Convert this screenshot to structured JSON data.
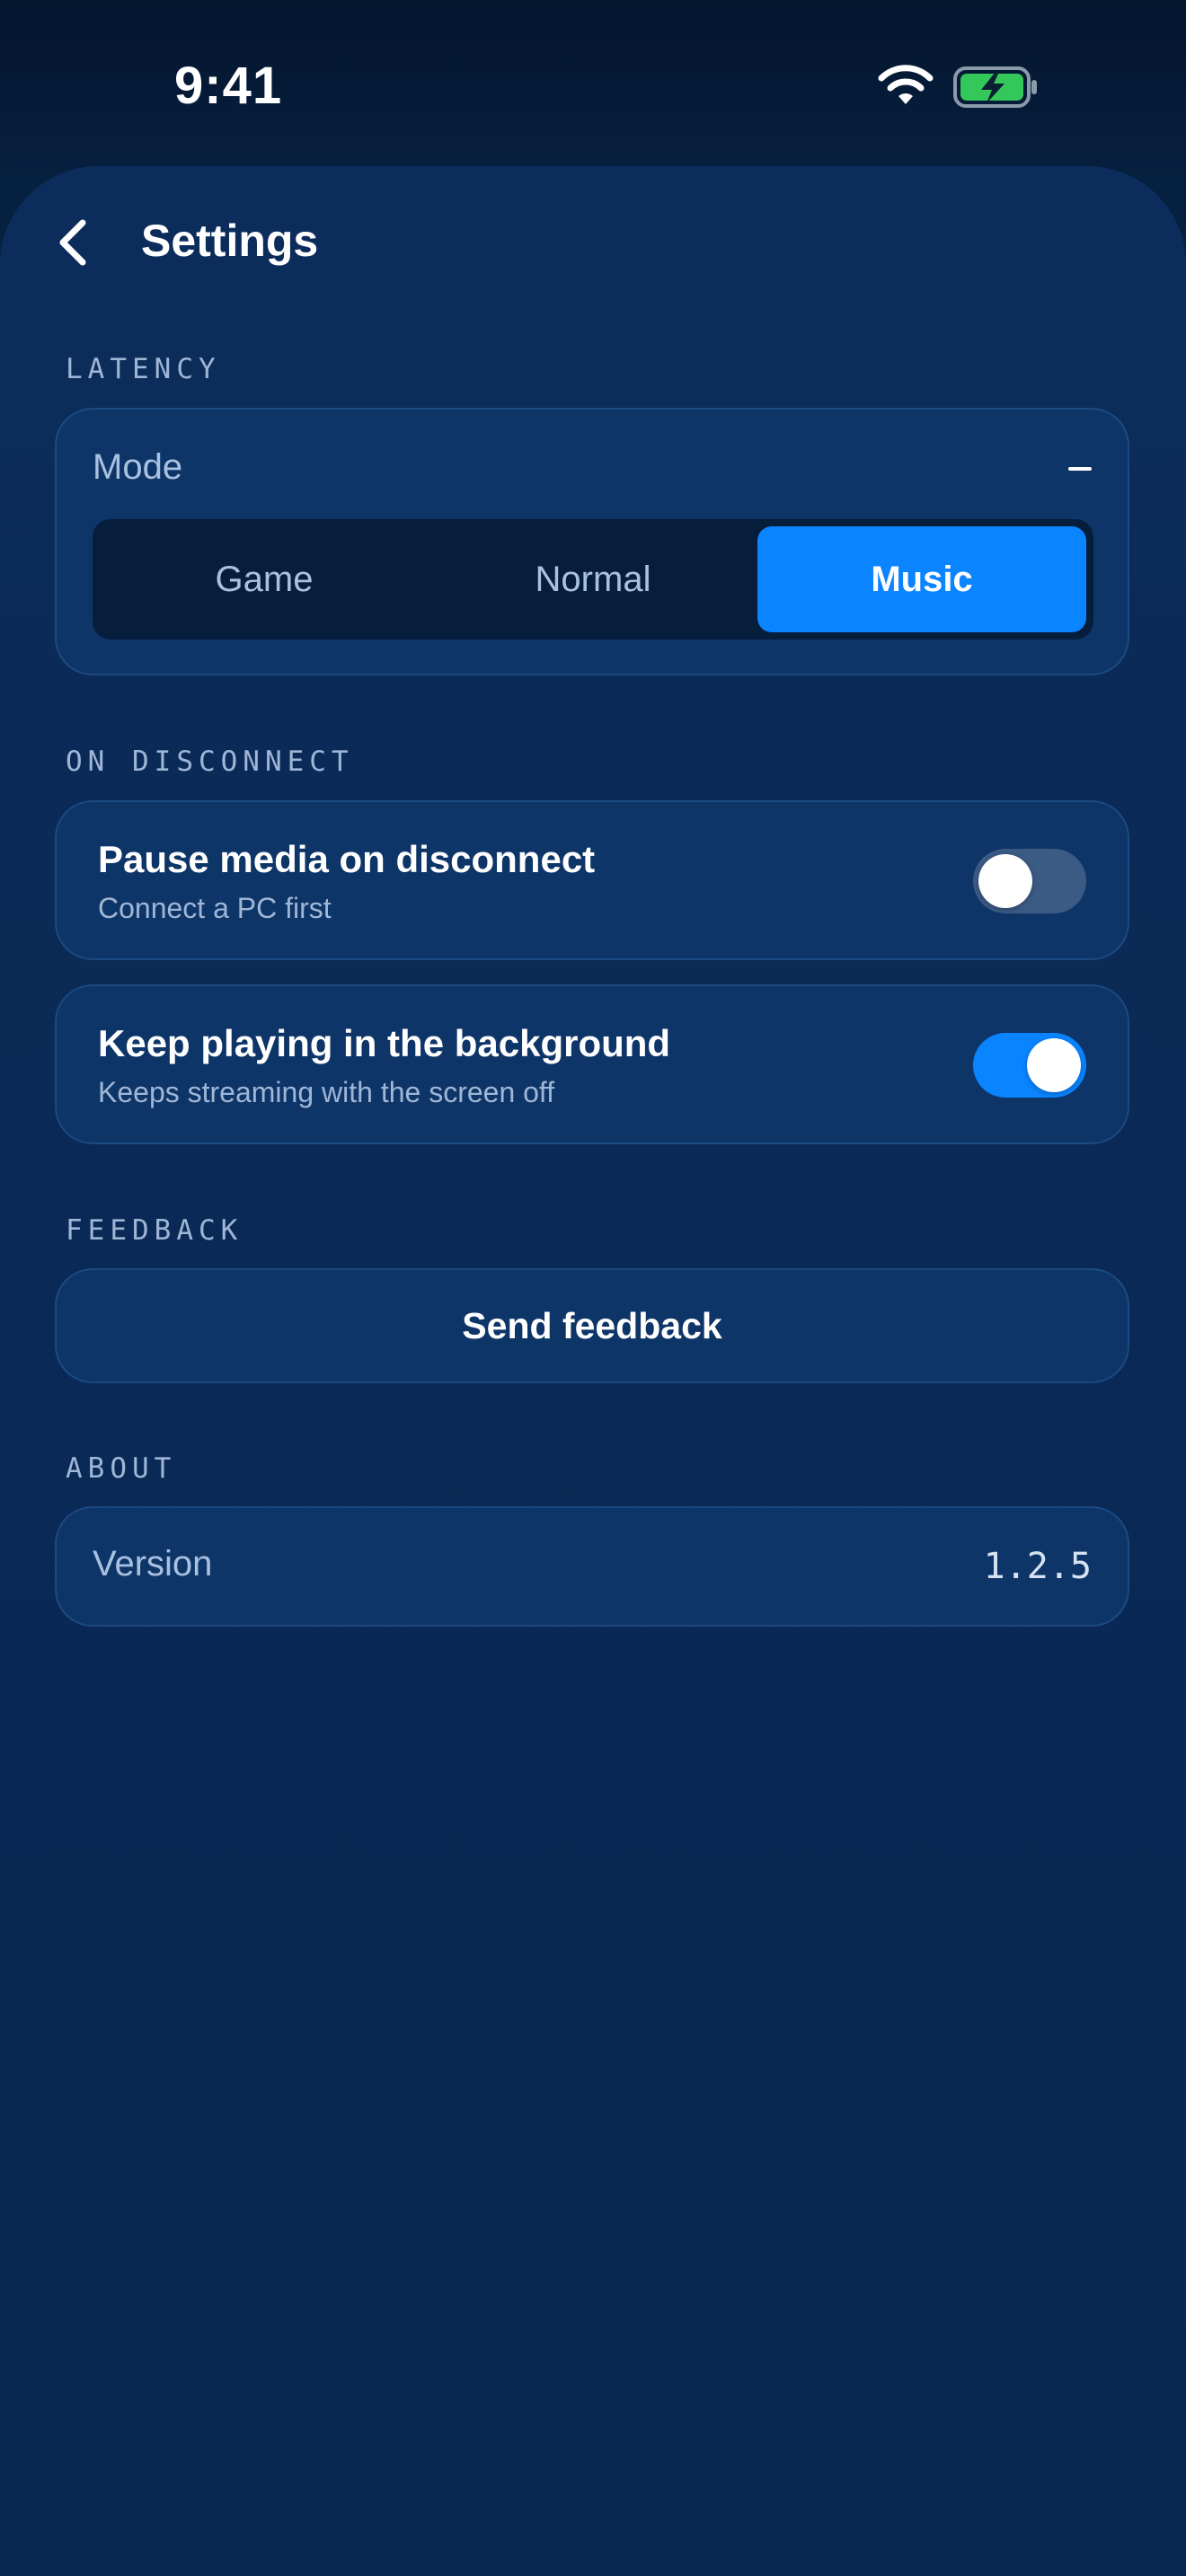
{
  "status_bar": {
    "time": "9:41",
    "icons": [
      "wifi-icon",
      "battery-charging-icon"
    ],
    "battery_color": "#34c759"
  },
  "header": {
    "title": "Settings"
  },
  "latency": {
    "section_label": "LATENCY",
    "mode_label": "Mode",
    "options": [
      "Game",
      "Normal",
      "Music"
    ],
    "selected": "Music"
  },
  "on_disconnect": {
    "section_label": "ON DISCONNECT",
    "items": [
      {
        "title": "Pause media on disconnect",
        "subtitle": "Connect a PC first",
        "enabled": false
      },
      {
        "title": "Keep playing in the background",
        "subtitle": "Keeps streaming with the screen off",
        "enabled": true
      }
    ]
  },
  "feedback": {
    "section_label": "FEEDBACK",
    "button_label": "Send feedback"
  },
  "about": {
    "section_label": "ABOUT",
    "version_label": "Version",
    "version_value": "1.2.5"
  },
  "colors": {
    "accent": "#0a84ff",
    "card_bg": "#0e3568",
    "background": "#0a2855"
  }
}
